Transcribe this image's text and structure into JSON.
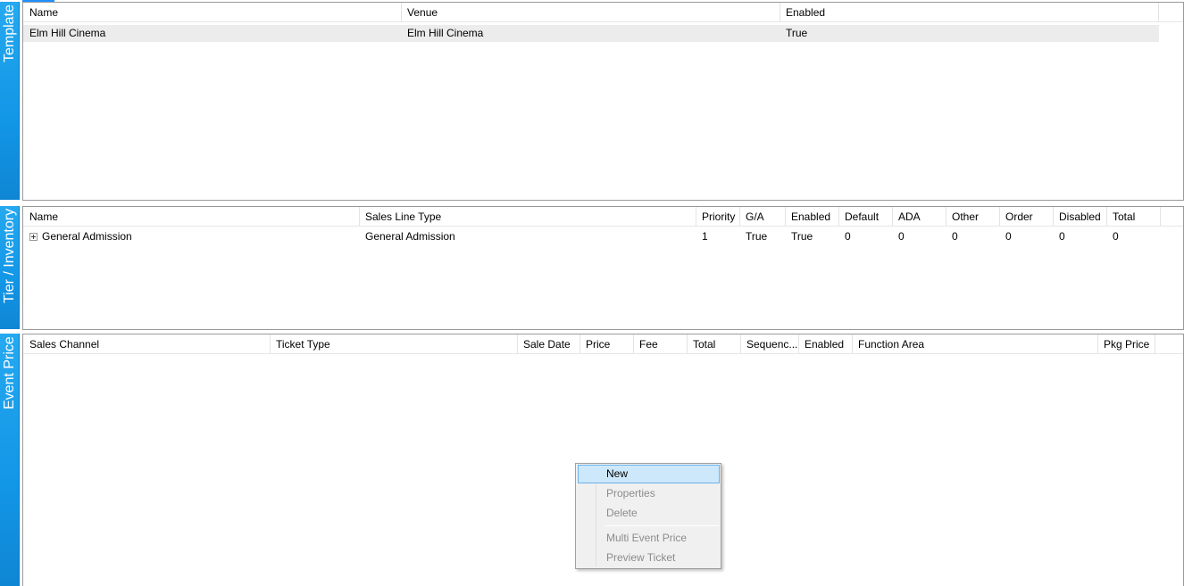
{
  "template": {
    "tab_label": "Template",
    "columns": [
      "Name",
      "Venue",
      "Enabled"
    ],
    "rows": [
      {
        "name": "Elm Hill Cinema",
        "venue": "Elm Hill Cinema",
        "enabled": "True"
      }
    ]
  },
  "tier_inventory": {
    "tab_label": "Tier / Inventory",
    "columns": [
      "Name",
      "Sales Line Type",
      "Priority",
      "G/A",
      "Enabled",
      "Default",
      "ADA",
      "Other",
      "Order",
      "Disabled",
      "Total"
    ],
    "rows": [
      {
        "name": "General Admission",
        "sales_line_type": "General Admission",
        "priority": "1",
        "ga": "True",
        "enabled": "True",
        "default": "0",
        "ada": "0",
        "other": "0",
        "order": "0",
        "disabled": "0",
        "total": "0"
      }
    ]
  },
  "event_price": {
    "tab_label": "Event Price",
    "columns": [
      "Sales Channel",
      "Ticket Type",
      "Sale Date",
      "Price",
      "Fee",
      "Total",
      "Sequenc...",
      "Enabled",
      "Function Area",
      "Pkg Price"
    ]
  },
  "context_menu": {
    "items": {
      "new": "New",
      "properties": "Properties",
      "delete": "Delete",
      "multi_event_price": "Multi Event Price",
      "preview_ticket": "Preview Ticket"
    }
  },
  "colors": {
    "tab_blue": "#1296e6",
    "menu_highlight": "#cde8fb",
    "selected_row": "#ececec"
  }
}
